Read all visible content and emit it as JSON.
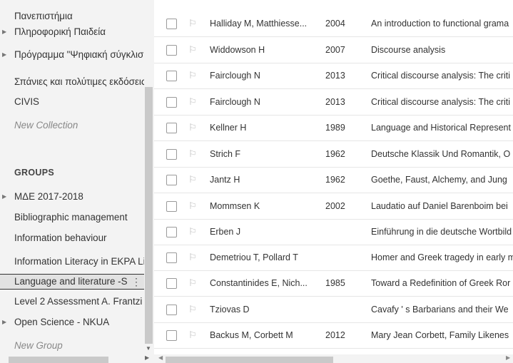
{
  "sidebar": {
    "items": [
      {
        "label": "Πανεπιστήμια",
        "arrow": false
      },
      {
        "label": "Πληροφορική Παιδεία",
        "arrow": true
      },
      {
        "label": "Πρόγραμμα \"Ψηφιακή σύγκλιση",
        "arrow": true
      },
      {
        "label": "Σπάνιες και πολύτιμες εκδόσεις",
        "arrow": false
      },
      {
        "label": "CIVIS",
        "arrow": false
      },
      {
        "label": "New Collection",
        "arrow": false
      }
    ],
    "groups_heading": "GROUPS",
    "groups": [
      {
        "label": "ΜΔΕ 2017-2018",
        "arrow": true
      },
      {
        "label": "Bibliographic management",
        "arrow": false
      },
      {
        "label": "Information behaviour",
        "arrow": false
      },
      {
        "label": "Information Literacy in EKPA Lib",
        "arrow": false
      },
      {
        "label": "Language and literature -S",
        "arrow": false
      },
      {
        "label": "Level 2 Assessment A. Frantzi",
        "arrow": false
      },
      {
        "label": "Open Science - NKUA",
        "arrow": true
      },
      {
        "label": "New Group",
        "arrow": false
      }
    ],
    "selected_menu_glyph": "⋮",
    "expand_glyph": "▶",
    "scroll_down_glyph": "▼"
  },
  "items": [
    {
      "author": "Halliday M, Matthiesse...",
      "year": "2004",
      "title": "An introduction to functional grama"
    },
    {
      "author": "Widdowson H",
      "year": "2007",
      "title": "Discourse analysis"
    },
    {
      "author": "Fairclough N",
      "year": "2013",
      "title": "Critical discourse analysis: The criti"
    },
    {
      "author": "Fairclough N",
      "year": "2013",
      "title": "Critical discourse analysis: The criti"
    },
    {
      "author": "Kellner H",
      "year": "1989",
      "title": "Language and Historical Represent"
    },
    {
      "author": "Strich F",
      "year": "1962",
      "title": "Deutsche Klassik Und Romantik, O"
    },
    {
      "author": "Jantz H",
      "year": "1962",
      "title": "Goethe, Faust, Alchemy, and Jung"
    },
    {
      "author": "Mommsen K",
      "year": "2002",
      "title": "Laudatio auf Daniel Barenboim bei"
    },
    {
      "author": "Erben J",
      "year": "",
      "title": "Einführung in die deutsche Wortbild"
    },
    {
      "author": "Demetriou T, Pollard T",
      "year": "",
      "title": "Homer and Greek tragedy in early m"
    },
    {
      "author": "Constantinides E, Nich...",
      "year": "1985",
      "title": "Toward a Redefinition of Greek Ror"
    },
    {
      "author": "Tziovas D",
      "year": "",
      "title": "Cavafy ' s Barbarians and their We"
    },
    {
      "author": "Backus M, Corbett M",
      "year": "2012",
      "title": "Mary Jean Corbett, Family Likenes"
    }
  ],
  "icons": {
    "flag": "⚐",
    "left": "◀",
    "right": "▶"
  }
}
